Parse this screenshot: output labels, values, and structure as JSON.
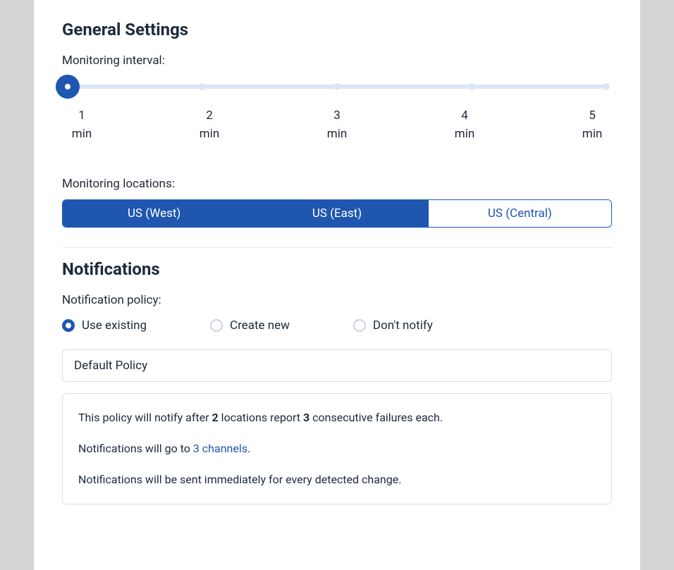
{
  "general": {
    "title": "General Settings",
    "interval_label": "Monitoring interval:",
    "slider": {
      "min": 1,
      "max": 5,
      "value": 1,
      "unit": "min",
      "ticks": [
        {
          "num": "1",
          "unit": "min"
        },
        {
          "num": "2",
          "unit": "min"
        },
        {
          "num": "3",
          "unit": "min"
        },
        {
          "num": "4",
          "unit": "min"
        },
        {
          "num": "5",
          "unit": "min"
        }
      ]
    },
    "locations_label": "Monitoring locations:",
    "locations": [
      {
        "label": "US (West)",
        "selected": true
      },
      {
        "label": "US (East)",
        "selected": true
      },
      {
        "label": "US (Central)",
        "selected": false
      }
    ]
  },
  "notifications": {
    "title": "Notifications",
    "policy_label": "Notification policy:",
    "radios": [
      {
        "label": "Use existing",
        "selected": true
      },
      {
        "label": "Create new",
        "selected": false
      },
      {
        "label": "Don't notify",
        "selected": false
      }
    ],
    "selected_policy": "Default Policy",
    "info": {
      "line1_prefix": "This policy will notify after ",
      "line1_locations": "2",
      "line1_mid": " locations report ",
      "line1_failures": "3",
      "line1_suffix": " consecutive failures each.",
      "line2_prefix": "Notifications will go to ",
      "line2_link": "3 channels",
      "line2_suffix": ".",
      "line3": "Notifications will be sent immediately for every detected change."
    }
  }
}
